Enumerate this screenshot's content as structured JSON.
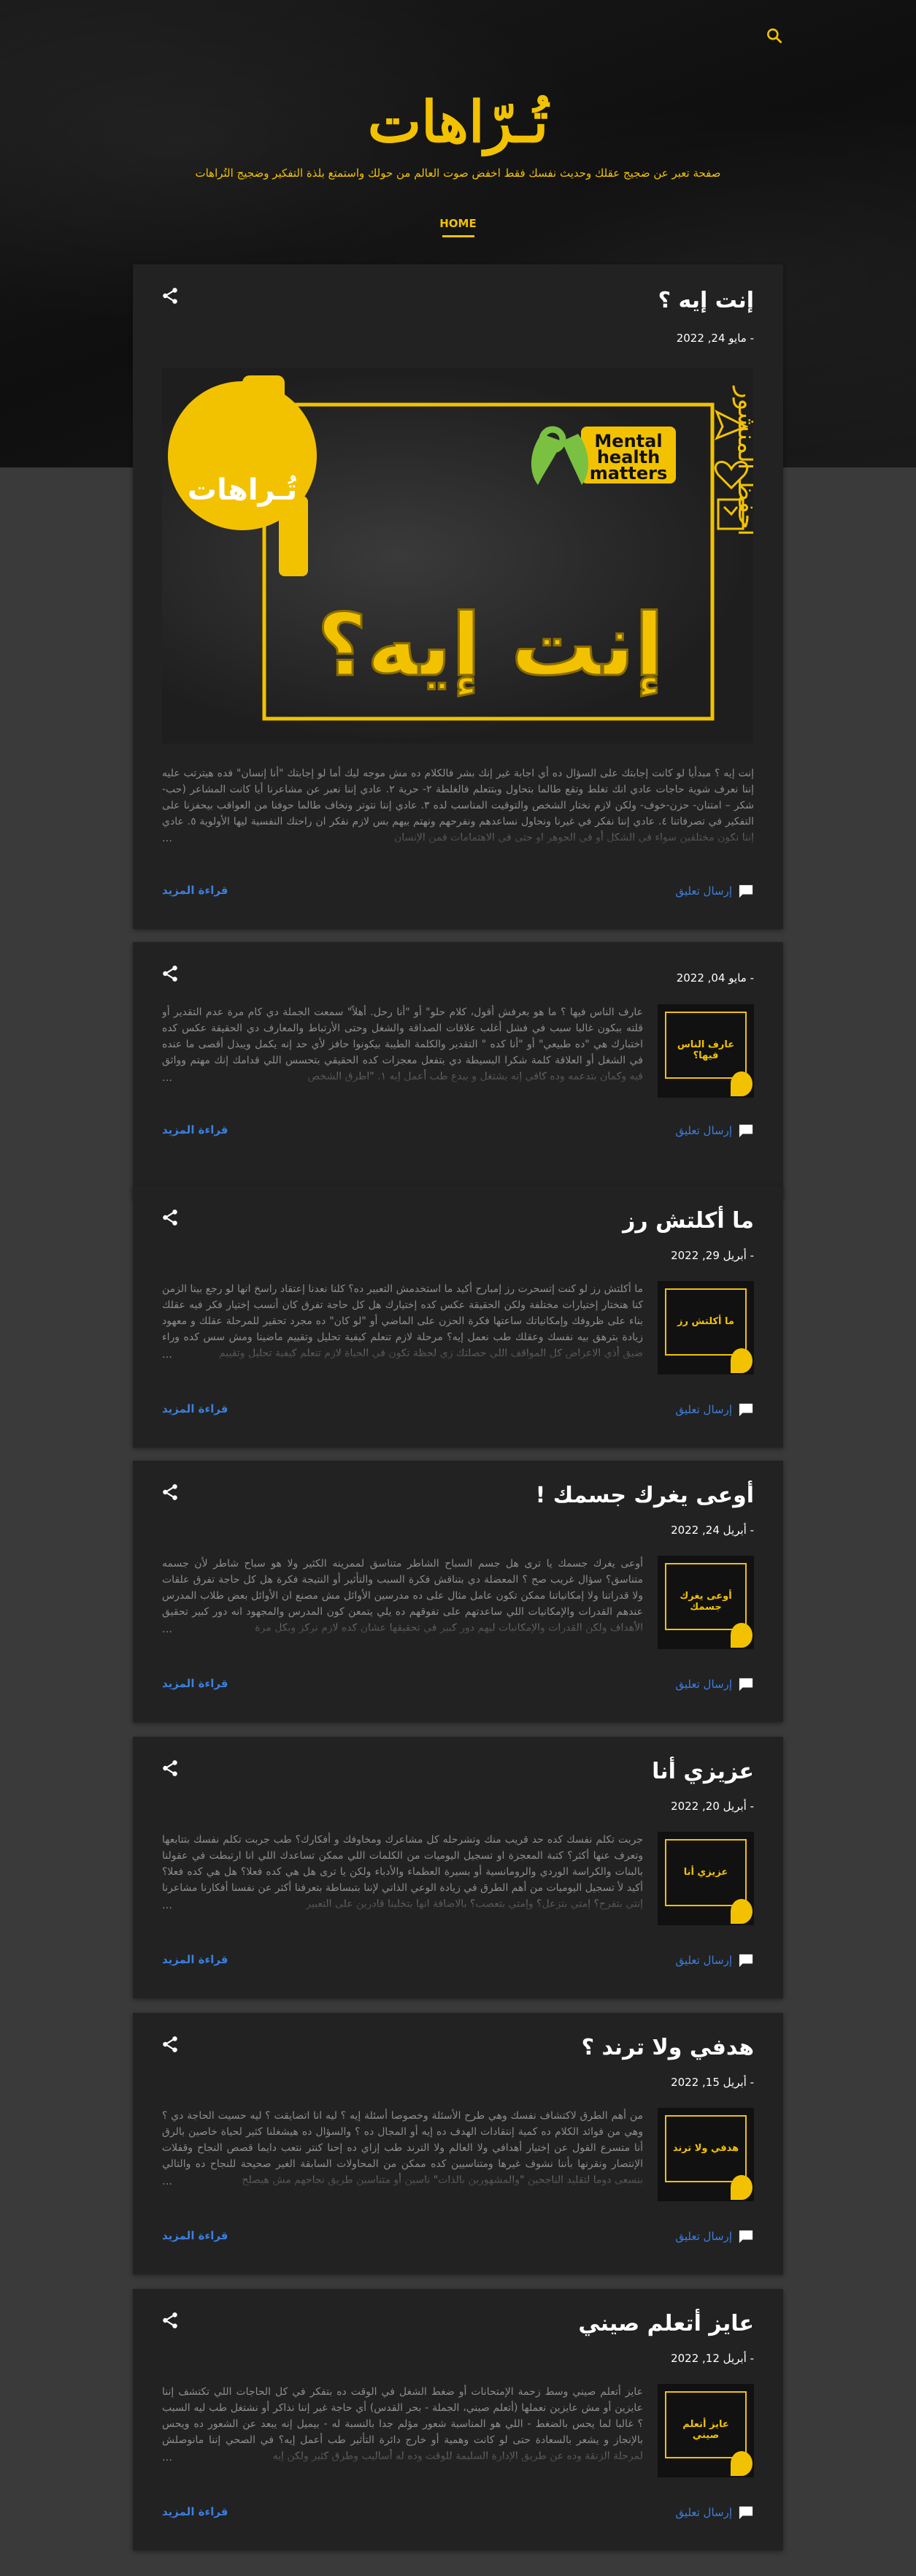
{
  "header": {
    "title": "تُـرّاهات",
    "description": "صفحة تعبر عن ضجيج عقلك وحديث نفسك فقط اخفض صوت العالم من حولك واستمتع بلذة التفكير وضجيج التُراهات",
    "nav_home": "HOME",
    "search_icon": "search-icon"
  },
  "colors": {
    "accent": "#f2c200",
    "link": "#3b7fe0",
    "card": "#222222",
    "page": "#3a3a3a"
  },
  "featured_image": {
    "logo_text": "تُـراهات",
    "badge": [
      "Mental",
      "health",
      "matters"
    ],
    "headline": "إنت إيه؟",
    "save_text": "احفظ المنشور"
  },
  "posts": [
    {
      "title": "إنت إيه ؟",
      "date": "- مايو 24, 2022",
      "excerpt": "إنت إيه ؟ مبدأيا لو كانت إجابتك على السؤال ده أي اجابة غير إنك بشر فالكلام ده مش موجه ليك أما لو إجابتك \"أنا إنسان\" فده هيترتب عليه إننا نعرف شوية حاجات عادي انك تغلط وتقع طالما بتحاول وبتتعلم فالغلطة ٢- حرية ٢. عادي إننا نعبر عن مشاعرنا أيا كانت المشاعر (حب- شكر – امتنان- حزن-خوف- ولكن لازم نختار الشخص والتوقيت المناسب لده ٣. عادي إننا نتوتر ونخاف طالما حوفنا من العواقب بيحفزنا على التفكير في تصرفاتنا ٤. عادي إننا نفكر في غيرنا ونحاول نساعدهم ونفرحهم ونهتم بيهم بس لازم نفكر ان راحتك النفسية ليها الأولوية ٥. عادي إننا نكون مختلفين سواء في الشكل أو في الجوهر او حتى في الاهتمامات فمن الإنسان",
      "comment": "إرسال تعليق",
      "read_more": "قراءة المزيد"
    },
    {
      "title": "",
      "date": "- مايو 04, 2022",
      "excerpt": "عارف الناس فيها ؟ ما هو بعرفش أقول، كلام حلو\" أو \"أنا رحل. أهلاً\" سمعت الجملة دي كام مرة عدم التقدير أو قلته ببكون غالبا سبب في فشل أغلب علاقات الصداقة والشغل وحتى الأرتباط والمعارف دي الحقيقة عكس كده اختبارك هي \"ده طبيعي\" أو \"أنا كده \" التقدير والكلمة الطيبة بيكونوا حافز لأي حد إنه يكمل ويبذل أقصى ما عنده في الشغل أو العلاقة كلمة شكرا البسيطة دي بتفعل معجزات كده الحقيقي بتحسس اللي قدامك إنك مهتم وواثق فيه وكمان بتدعمه وده كافي إنه يشتغل و يبدع طب أعمل إيه ١. \"اطرق الشخص",
      "thumb_label": "عارف الناس فيها؟",
      "comment": "إرسال تعليق",
      "read_more": "قراءة المزيد"
    },
    {
      "title": "ما أكلتش رز",
      "date": "- أبريل 29, 2022",
      "excerpt": "ما أكلتش رز لو كنت إتسحرت رز إمبارح أكيد ما استخدمش التعبير ده؟ كلنا نعدنا إعتقاد راسخ انها لو رجع بينا الزمن كنا هنختار إختيارات مختلفة ولكن الحقيقة عكس كده إختيارك هل كل حاجة تفرق كان أنسب إختيار فكر فيه عقلك بناء على ظروفك وإمكانياتك ساعتها فكرة الحزن على الماضي أو \"لو كان\" ده مجرد تحقير للمرحلة عقلك و معهود زيادة بترهق بيه نفسك وعقلك طب نعمل إيه؟ مرحلة لازم تنعلم كيفية تحليل وتقييم ماضينا ومش سس كده وراء ضيق أذي الاعراض كل المواقف اللي حصلتك زي لحظة تكون في الحياة لازم تنعلم كيفية تحليل وتقييم",
      "thumb_label": "ما أكلتش رز",
      "comment": "إرسال تعليق",
      "read_more": "قراءة المزيد"
    },
    {
      "title": "أوعى يغرك جسمك !",
      "date": "- أبريل 24, 2022",
      "excerpt": "أوعى يغرك جسمك يا ترى هل جسم السباح الشاطر متناسق لممرينه الكثير ولا هو سباح شاطر لأن جسمه متناسق؟ سؤال غريب صح ؟ المعضلة دي بتناقش فكرة السبب والتأثير أو النتيجة فكرة هل كل حاجة تفرق علقات ولا قدراتنا ولا إمكانياتنا ممكن تكون عامل مثال على ده مدرسين الأوائل مش مصنع ان الأوائل بعض طلاب المدرس عندهم القدرات والإمكانيات اللي ساعدتهم على تفوقهم ده يلي يتمعن كون المدرس والمجهود انه دور كبير تحقيق الأهداف ولكن القدرات والإمكانيات ليهم دور كبير في تحقيقها عشان كده لازم نركز وبكل مرة",
      "thumb_label": "أوعى يغرك جسمك",
      "comment": "إرسال تعليق",
      "read_more": "قراءة المزيد"
    },
    {
      "title": "عزيزي أنا",
      "date": "- أبريل 20, 2022",
      "excerpt": "جربت تكلم نفسك كده حد قريب منك وتشرحله كل مشاعرك ومخاوفك و أفكارك؟ طب جربت تكلم نفسك بتتابعها وتعرف عنها أكثر؟ كتبة المعجزة او تسجيل اليوميات من الكلمات اللي ممكن تساعدك اللي انا ارتبطت في عقولنا بالبنات والكراسة الوردي والرومانسية أو بسيرة العظماء والأدباء ولكن يا ترى هل هي كده فعلا؟ هل هي كده فعلا؟ أكيد لأ تسجيل اليوميات من أهم الطرق في زيادة الوعي الذاتي لإننا بتبساطة بتعرفنا أكثر عن نفسنا أفكارنا مشاعرنا إنتي بتفرح؟ إمتي بتزعل؟ وإمتي بتعصب؟ بالاضافة انها بتخلينا قادرين على التعبير",
      "thumb_label": "عزيزي أنا",
      "comment": "إرسال تعليق",
      "read_more": "قراءة المزيد"
    },
    {
      "title": "هدفي ولا ترند ؟",
      "date": "- أبريل 15, 2022",
      "excerpt": "من أهم الطرق لاكتشاف نفسك وهي طرح الأسئلة وخصوصا أسئلة إيه ؟ ليه انا اتضايقت ؟ ليه حسيت الحاجة دي ؟ وهي من فوائد الكلام ده كمية إنتقادات الهدف ده إيه أو المجال ده ؟ والسؤال ده هيشغلنا كثير لحياة خاصين بالرق أنا متسرع القول عن إختيار أهدافي ولا العالم ولا الترند طب إزاي ده إحنا كنتر نتعب دايما قصص النجاح وقفلات الإنتصار ونقرنها بأننا نشوف غيرها ومتناسيين كده ممكن من المحاولات السابقة الغير صحيحة للنجاح ده والتالي بنسعى دوما لتقليد الناجحين \"والمشهورين بالذات\" ناسين أو متناسين طريق نجاحهم مش هيصلح",
      "thumb_label": "هدفي ولا ترند",
      "comment": "إرسال تعليق",
      "read_more": "قراءة المزيد"
    },
    {
      "title": "عايز أتعلم صيني",
      "date": "- أبريل 12, 2022",
      "excerpt": "عايز أتعلم صيني وسط زحمة الإمتحانات أو ضغط الشغل في الوقت ده بتفكر في كل الحاجات اللي تكتشف إننا عايزين أو مش عايزين نعملها (أتعلم صيني، الجملة - بحر القدس) أي حاجة غير إننا نذاكر أو نشتغل طب ليه السبب ؟ غالبا لما يحس بالضغط - اللي هو المناسبة شعور مؤلم جدا بالنسبة له - بيميل إنه يبعد عن الشعور ده ويحس بالإنجاز و يشعر بالسعادة حتى لو كانت وهمية أو خارج دائرة التأثير طب أعمل إيه؟ في الصحي إننا مانوصلش لمرحلة الزنقة وده عن طريق الإدارة السليمة للوقت وده له أساليب وطرق كثير ولكن إيه",
      "thumb_label": "عايز أتعلم صيني",
      "comment": "إرسال تعليق",
      "read_more": "قراءة المزيد"
    }
  ]
}
